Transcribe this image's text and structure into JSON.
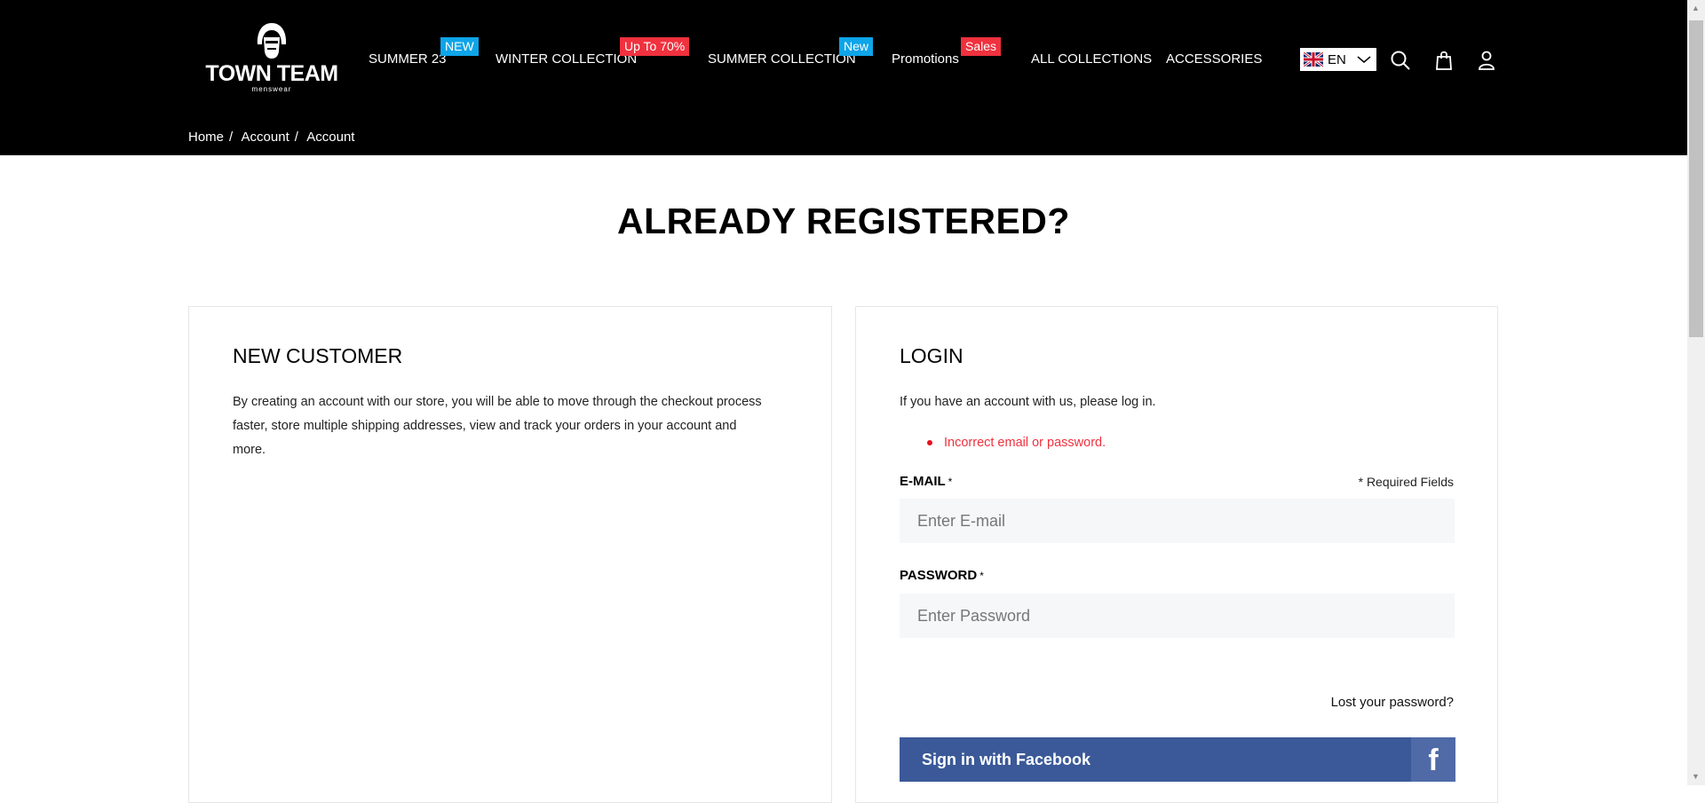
{
  "header": {
    "logo": {
      "brand": "TOWN TEAM",
      "sub": "menswear"
    },
    "nav": [
      {
        "label": "SUMMER 23",
        "badge": "NEW",
        "badge_color": "#0ea5e9"
      },
      {
        "label": "WINTER COLLECTION",
        "badge": "Up To 70%",
        "badge_color": "#f0313e"
      },
      {
        "label": "SUMMER COLLECTION",
        "badge": "New",
        "badge_color": "#0ea5e9"
      },
      {
        "label": "Promotions",
        "badge": "Sales",
        "badge_color": "#f0313e"
      },
      {
        "label": "ALL COLLECTIONS"
      },
      {
        "label": "ACCESSORIES"
      }
    ],
    "language": "EN",
    "icons": [
      "uk-flag-icon",
      "chevron-down-icon",
      "search-icon",
      "shopping-bag-icon",
      "user-icon"
    ]
  },
  "breadcrumb": [
    "Home",
    "Account",
    "Account"
  ],
  "page_title": "ALREADY REGISTERED?",
  "new_customer": {
    "title": "NEW CUSTOMER",
    "text": "By creating an account with our store, you will be able to move through the checkout process faster, store multiple shipping addresses, view and track your orders in your account and more."
  },
  "login": {
    "title": "LOGIN",
    "intro": "If you have an account with us, please log in.",
    "error": "Incorrect email or password.",
    "email_label": "E-MAIL",
    "required_star": "*",
    "required_note": "* Required Fields",
    "email_placeholder": "Enter E-mail",
    "email_value": "",
    "password_label": "PASSWORD",
    "password_placeholder": "Enter Password",
    "password_value": "",
    "lost_password": "Lost your password?",
    "facebook_label": "Sign in with Facebook",
    "facebook_icon": "f"
  },
  "colors": {
    "error": "#f0313e",
    "facebook": "#3b5998"
  }
}
